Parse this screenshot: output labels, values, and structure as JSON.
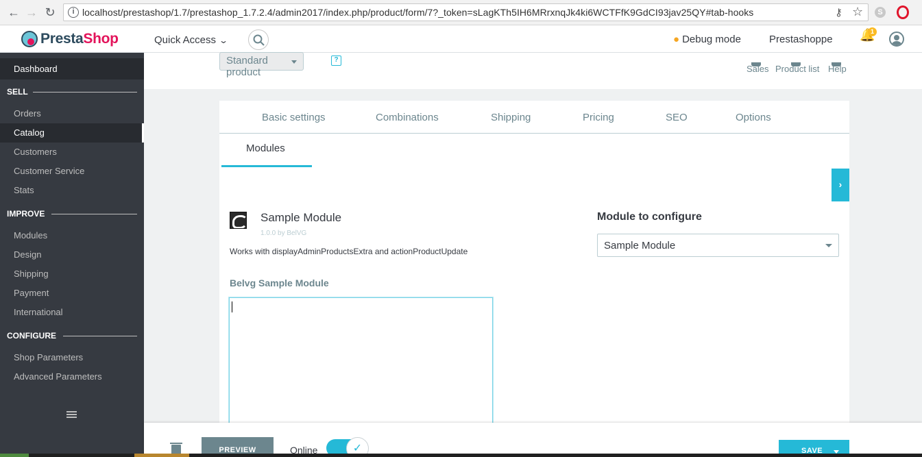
{
  "browser": {
    "url": "localhost/prestashop/1.7/prestashop_1.7.2.4/admin2017/index.php/product/form/7?_token=sLagKTh5IH6MRrxnqJk4ki6WCTFfK9GdCI93jav25QY#tab-hooks"
  },
  "header": {
    "logo_presta": "Presta",
    "logo_shop": "Shop",
    "quick_access": "Quick Access",
    "debug_mode": "Debug mode",
    "shop_name": "Prestashoppe",
    "notification_count": "1"
  },
  "sidebar": {
    "dashboard": "Dashboard",
    "sections": [
      {
        "title": "SELL",
        "items": [
          "Orders",
          "Catalog",
          "Customers",
          "Customer Service",
          "Stats"
        ]
      },
      {
        "title": "IMPROVE",
        "items": [
          "Modules",
          "Design",
          "Shipping",
          "Payment",
          "International"
        ]
      },
      {
        "title": "CONFIGURE",
        "items": [
          "Shop Parameters",
          "Advanced Parameters"
        ]
      }
    ],
    "active_item": "Catalog"
  },
  "toolbar": {
    "product_type": "Standard product",
    "help_mark": "?",
    "links": [
      "Sales",
      "Product list",
      "Help"
    ]
  },
  "tabs": {
    "items": [
      "Basic settings",
      "Combinations",
      "Shipping",
      "Pricing",
      "SEO",
      "Options"
    ],
    "active": "Modules"
  },
  "module": {
    "title": "Sample Module",
    "version": "1.0.0 by BelVG",
    "description": "Works with displayAdminProductsExtra and actionProductUpdate",
    "field_label": "Belvg Sample Module",
    "textarea_value": ""
  },
  "configure": {
    "label": "Module to configure",
    "selected": "Sample Module"
  },
  "footer": {
    "preview": "PREVIEW",
    "online": "Online",
    "save": "SAVE"
  },
  "colors": {
    "accent": "#25b9d7",
    "sidebar_bg": "#363a41",
    "logo_pink": "#e3145b"
  }
}
